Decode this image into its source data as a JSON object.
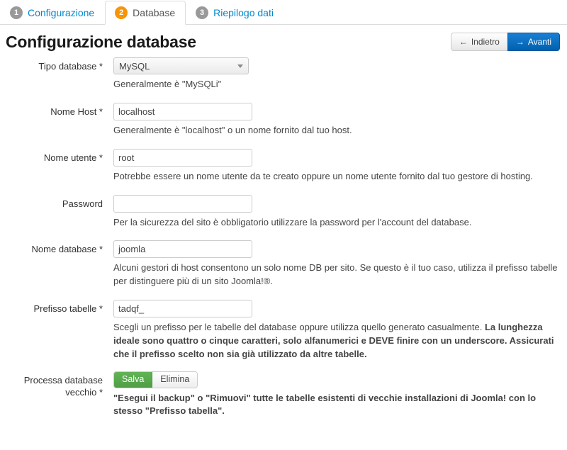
{
  "tabs": [
    {
      "number": "1",
      "label": "Configurazione",
      "active": false
    },
    {
      "number": "2",
      "label": "Database",
      "active": true
    },
    {
      "number": "3",
      "label": "Riepilogo dati",
      "active": false
    }
  ],
  "header": {
    "title": "Configurazione database",
    "back_label": "Indietro",
    "back_icon": "arrow-left-icon",
    "next_label": "Avanti",
    "next_icon": "arrow-right-icon"
  },
  "form": {
    "db_type": {
      "label": "Tipo database *",
      "value": "MySQL",
      "help": "Generalmente è \"MySQLi\""
    },
    "host": {
      "label": "Nome Host *",
      "value": "localhost",
      "help": "Generalmente è \"localhost\" o un nome fornito dal tuo host."
    },
    "username": {
      "label": "Nome utente *",
      "value": "root",
      "help": "Potrebbe essere un nome utente da te creato oppure un nome utente fornito dal tuo gestore di hosting."
    },
    "password": {
      "label": "Password",
      "value": "",
      "help": "Per la sicurezza del sito è obbligatorio utilizzare la password per l'account del database."
    },
    "db_name": {
      "label": "Nome database *",
      "value": "joomla",
      "help": "Alcuni gestori di host consentono un solo nome DB per sito. Se questo è il tuo caso, utilizza il prefisso tabelle per distinguere più di un sito Joomla!®."
    },
    "prefix": {
      "label": "Prefisso tabelle *",
      "value": "tadqf_",
      "help_normal": "Scegli un prefisso per le tabelle del database oppure utilizza quello generato casualmente. ",
      "help_bold": "La lunghezza ideale sono quattro o cinque caratteri, solo alfanumerici e DEVE finire con un underscore. Assicurati che il prefisso scelto non sia già utilizzato da altre tabelle."
    },
    "old_db": {
      "label": "Processa database vecchio *",
      "save_label": "Salva",
      "delete_label": "Elimina",
      "selected": "Salva",
      "help": "\"Esegui il backup\" o \"Rimuovi\" tutte le tabelle esistenti di vecchie installazioni di Joomla! con lo stesso \"Prefisso tabella\"."
    }
  },
  "colors": {
    "accent_blue": "#0088cc",
    "badge_active": "#f89406",
    "badge_inactive": "#999999",
    "next_button": "#0069b8",
    "toggle_on": "#56a84b"
  }
}
